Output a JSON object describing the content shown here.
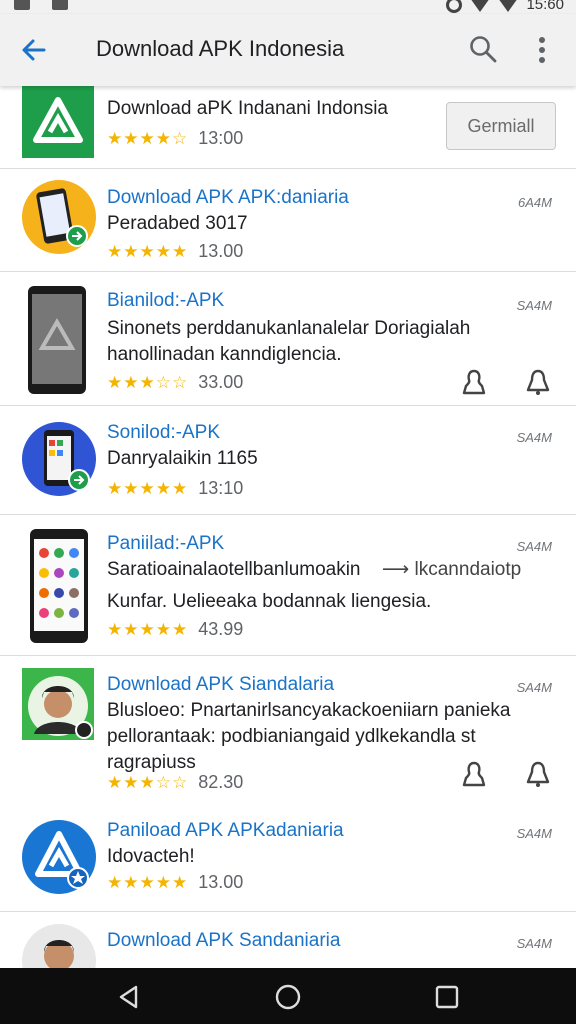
{
  "status_bar": {
    "time": "15:60"
  },
  "app_bar": {
    "title": "Download APK Indonesia"
  },
  "header_app": {
    "name": "Download aPK Indanani Indonsia",
    "rating_stars": "★★★★☆",
    "rating_value": "13:00",
    "install_label": "Germiall"
  },
  "apps": [
    {
      "name": "Download APK APK:daniaria",
      "desc": "Peradabed 3017",
      "stars": "★★★★★",
      "value": "13.00",
      "size": "6A4M"
    },
    {
      "name": "Bianilod:-APK",
      "desc": "Sinonets perddanukanlanalelar Doriagialah hanollinadan kanndiglencia.",
      "stars": "★★★☆☆",
      "value": "33.00",
      "size": "SA4M"
    },
    {
      "name": "Sonilod:-APK",
      "desc": "Danryalaikin 1165",
      "stars": "★★★★★",
      "value": "13:10",
      "size": "SA4M"
    },
    {
      "name": "Paniilad:-APK",
      "desc": "Saratioainalaotellbanlumoakin",
      "desc_extra": "⟶ lkcanndaiotp",
      "desc2": "Kunfar. Uelieeaka bodannak liengesia.",
      "stars": "★★★★★",
      "value": "43.99",
      "size": "SA4M"
    },
    {
      "name": "Download APK Siandalaria",
      "desc": "Blusloeo: Pnartanirlsancyakackoeniiarn panieka pellorantaak: podbianiangaid ydlkekandla st ragrapiuss",
      "stars": "★★★☆☆",
      "value": "82.30",
      "size": "SA4M"
    },
    {
      "name": "Paniload APK APKadaniaria",
      "desc": "Idovacteh!",
      "stars": "★★★★★",
      "value": "13.00",
      "size": "SA4M"
    },
    {
      "name": "Download APK Sandaniaria",
      "desc": "",
      "stars": "",
      "value": "",
      "size": "SA4M"
    }
  ],
  "colors": {
    "accent": "#1a73c8",
    "star": "#f5b400",
    "green": "#1e9e4b"
  }
}
